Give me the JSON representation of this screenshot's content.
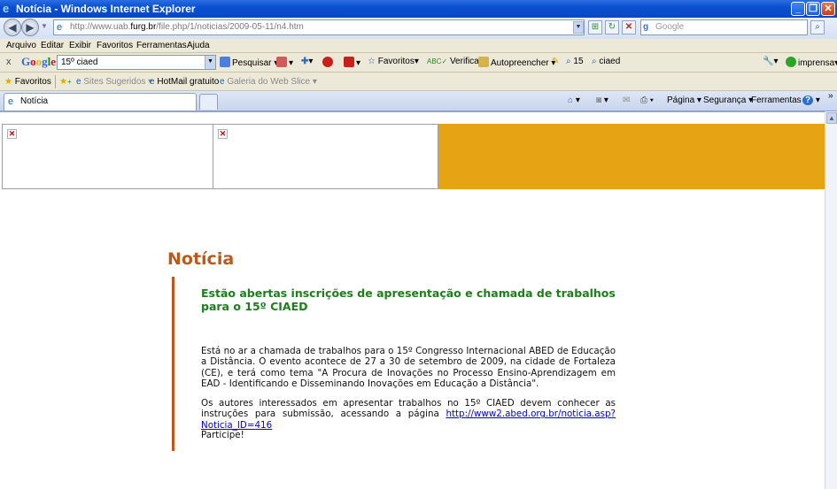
{
  "window": {
    "title": "Notícia - Windows Internet Explorer"
  },
  "address": {
    "prefix": "http://www.uab.",
    "domain": "furg.br",
    "suffix": "/file.php/1/noticias/2009-05-11/n4.htm",
    "search_placeholder": "Google"
  },
  "menu": {
    "items": [
      "Arquivo",
      "Editar",
      "Exibir",
      "Favoritos",
      "Ferramentas",
      "Ajuda"
    ]
  },
  "google_toolbar": {
    "logo": "Google",
    "query": "15º ciaed",
    "pesquisar": "Pesquisar",
    "favoritos": "Favoritos",
    "verificar": "Verificar",
    "autopreencher": "Autopreencher",
    "count": "15",
    "term": "ciaed",
    "imprensa": "imprensa"
  },
  "favorites_bar": {
    "favoritos": "Favoritos",
    "sites": "Sites Sugeridos",
    "hotmail": "HotMail gratuito",
    "galeria": "Galeria do Web Slice"
  },
  "tabs": {
    "active": "Notícia"
  },
  "commands": {
    "pagina": "Página",
    "seguranca": "Segurança",
    "ferramentas": "Ferramentas"
  },
  "article": {
    "section_title": "Notícia",
    "headline": "Estão abertas inscrições de apresentação e chamada de trabalhos para o 15º CIAED",
    "p1": "Está no ar a chamada de trabalhos para o 15º Congresso Internacional ABED de Educação a Distância. O evento acontece de 27 a 30 de setembro de 2009, na cidade de Fortaleza (CE), e terá como tema \"A Procura de Inovações no Processo Ensino-Aprendizagem em EAD - Identificando e Disseminando Inovações em Educação a Distância\".",
    "p2": "Os autores interessados em apresentar trabalhos no 15º CIAED devem conhecer as instruções para submissão, acessando a página",
    "link": "http://www2.abed.org.br/noticia.asp?Noticia_ID=416",
    "p3": "Participe!"
  },
  "colors": {
    "accent_orange": "#e6a314",
    "title_brown": "#b85a1c",
    "headline_green": "#1c7f1c",
    "bar": "#c0551d"
  }
}
